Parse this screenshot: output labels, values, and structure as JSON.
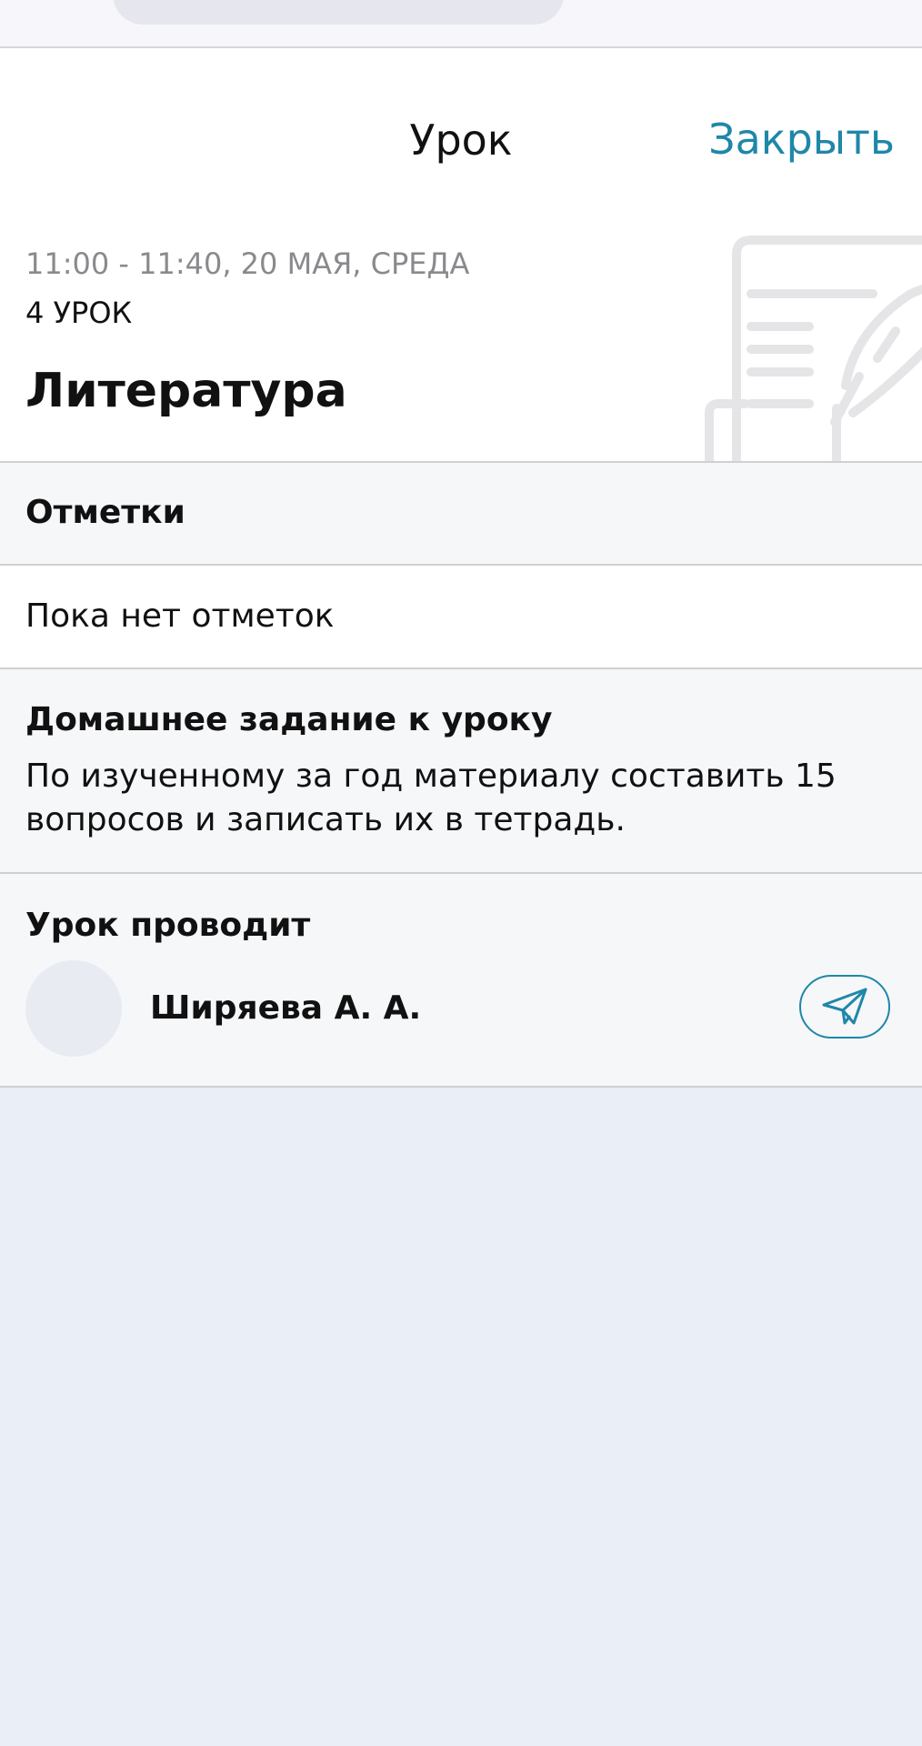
{
  "nav": {
    "title": "Урок",
    "close_label": "Закрыть"
  },
  "lesson": {
    "time": "11:00 - 11:40, 20 МАЯ, СРЕДА",
    "number": "4 УРОК",
    "subject": "Литература",
    "icon": "scroll-quill-icon"
  },
  "marks": {
    "heading": "Отметки",
    "empty_text": "Пока нет отметок"
  },
  "homework": {
    "heading": "Домашнее задание к уроку",
    "line1": "По изученному за год материалу составить 15",
    "line2": "вопросов и записать их в тетрадь."
  },
  "teacher": {
    "heading": "Урок проводит",
    "name": "Ширяева А. А.",
    "message_icon": "paper-plane-icon"
  },
  "colors": {
    "accent": "#1f87a8",
    "page_background": "#eaeef6",
    "section_background": "#f6f7f9",
    "muted_text": "#8a8a8e"
  }
}
